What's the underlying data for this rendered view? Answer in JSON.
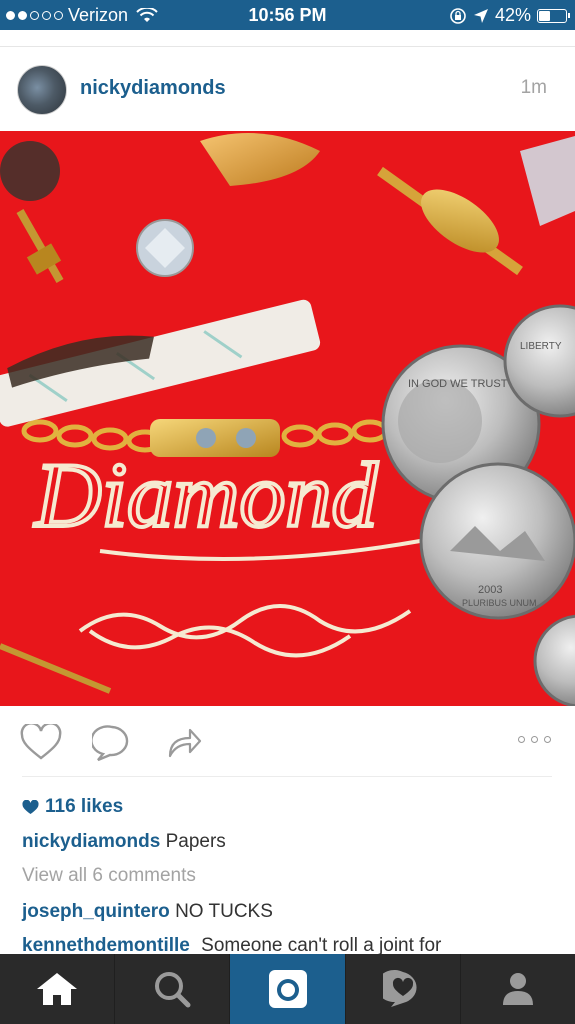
{
  "status_bar": {
    "carrier": "Verizon",
    "time": "10:56 PM",
    "battery": "42%",
    "battery_level": 0.42,
    "signal_bars_filled": 2,
    "signal_bars_total": 5
  },
  "post": {
    "username": "nickydiamonds",
    "time_ago": "1m",
    "likes": "116 likes",
    "caption": {
      "user": "nickydiamonds",
      "text": "Papers"
    },
    "view_all": "View all 6 comments",
    "comments": [
      {
        "user": "joseph_quintero",
        "text": "NO TUCKS"
      },
      {
        "user": "kennethdemontille",
        "text": "Someone can't roll a joint for"
      }
    ],
    "photo_text": "Diamond",
    "coin_text_1": "IN GOD WE TRUST",
    "coin_text_2": "LIBERTY",
    "coin_text_3": "2003",
    "coin_text_4": "PLURIBUS UNUM"
  },
  "colors": {
    "brand_blue": "#1c5f8e",
    "tab_bar": "#2a2a2a",
    "photo_red": "#e8161b"
  },
  "tabs": [
    {
      "icon": "home-icon",
      "active": false
    },
    {
      "icon": "search-icon",
      "active": false
    },
    {
      "icon": "camera-icon",
      "active": true
    },
    {
      "icon": "activity-icon",
      "active": false
    },
    {
      "icon": "profile-icon",
      "active": false
    }
  ]
}
